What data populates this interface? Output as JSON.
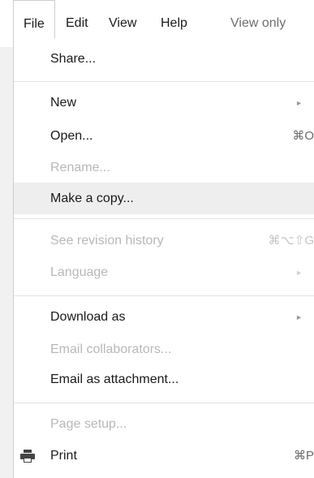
{
  "menubar": {
    "items": [
      {
        "label": "File"
      },
      {
        "label": "Edit"
      },
      {
        "label": "View"
      },
      {
        "label": "Help"
      },
      {
        "label": "View only"
      }
    ]
  },
  "file_menu": {
    "items": [
      {
        "label": "Share...",
        "enabled": true
      },
      {
        "label": "New",
        "enabled": true,
        "submenu": true,
        "arrow": "►"
      },
      {
        "label": "Open...",
        "enabled": true,
        "shortcut": "⌘O"
      },
      {
        "label": "Rename...",
        "enabled": false
      },
      {
        "label": "Make a copy...",
        "enabled": true,
        "highlighted": true
      },
      {
        "label": "See revision history",
        "enabled": false,
        "shortcut": "⌘⌥⇧G"
      },
      {
        "label": "Language",
        "enabled": false,
        "submenu": true,
        "arrow": "►"
      },
      {
        "label": "Download as",
        "enabled": true,
        "submenu": true,
        "arrow": "►"
      },
      {
        "label": "Email collaborators...",
        "enabled": false
      },
      {
        "label": "Email as attachment...",
        "enabled": true
      },
      {
        "label": "Page setup...",
        "enabled": false
      },
      {
        "label": "Print",
        "enabled": true,
        "shortcut": "⌘P",
        "icon": "printer-icon"
      }
    ]
  }
}
